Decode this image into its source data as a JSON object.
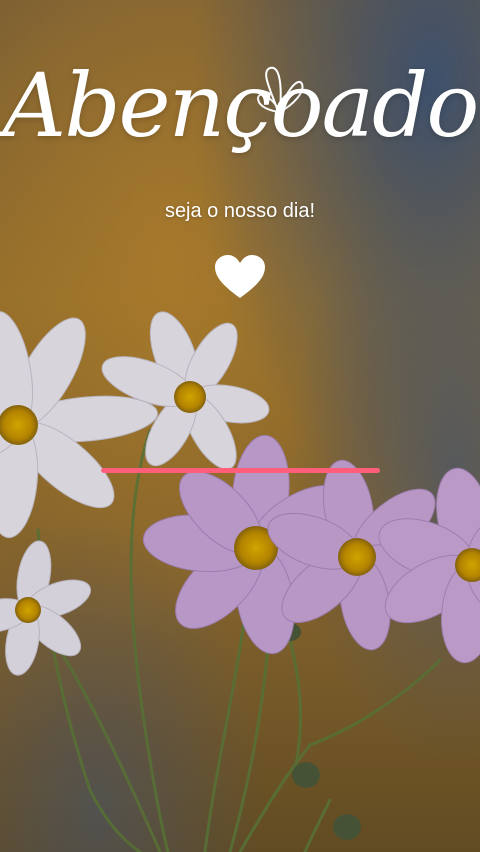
{
  "title": "Abençoado",
  "subtitle": "seja o nosso dia!",
  "icons": {
    "decoration": "butterfly-icon",
    "like": "heart-icon"
  },
  "progress": {
    "fraction": 1.0,
    "color": "#ff5e7a"
  },
  "colors": {
    "text": "#ffffff"
  }
}
